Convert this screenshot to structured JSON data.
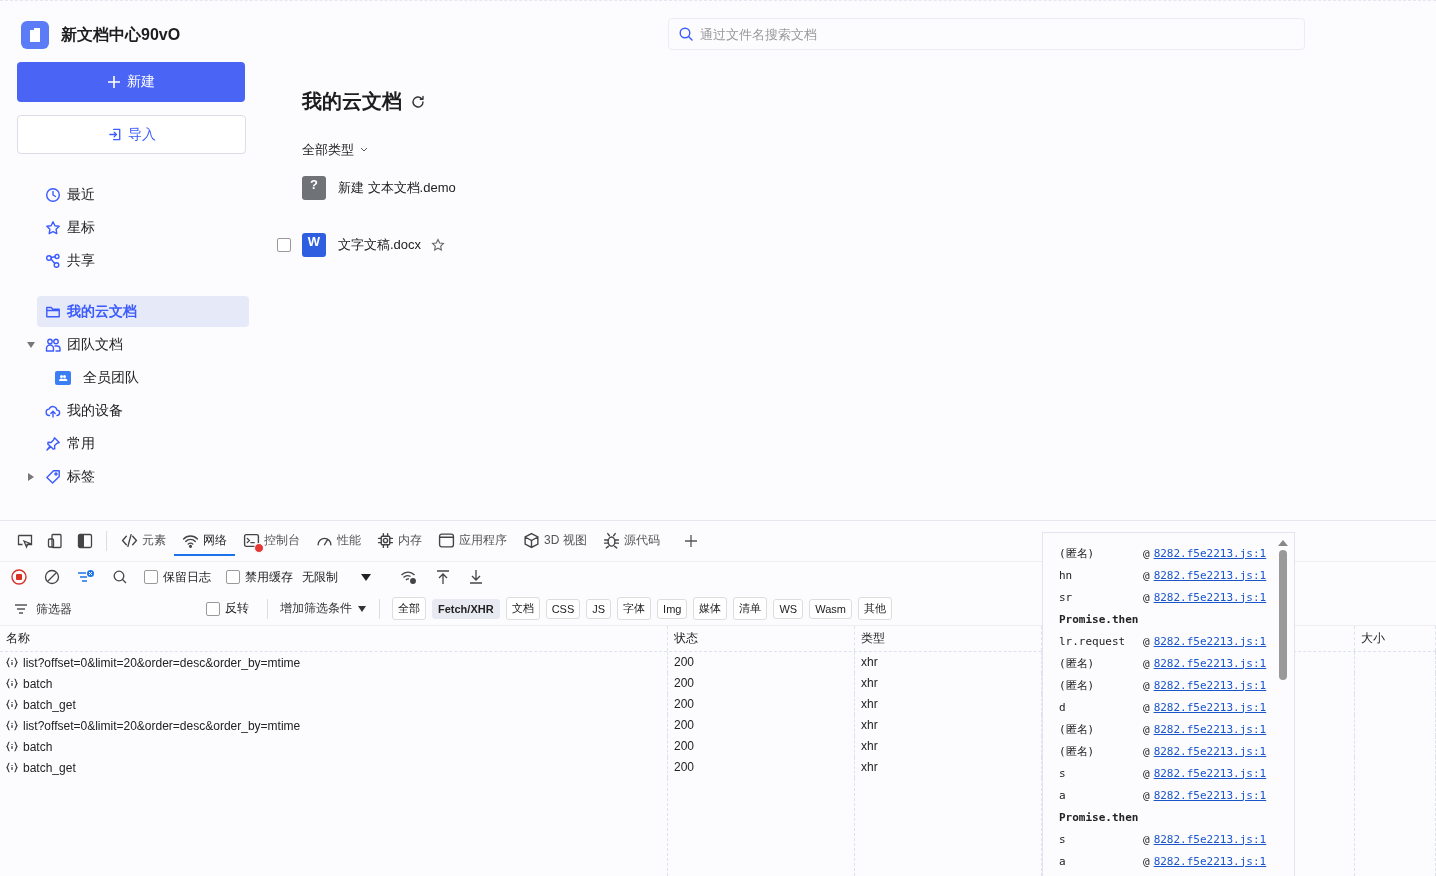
{
  "app": {
    "name": "新文档中心90vO",
    "new_button": "新建",
    "import_button": "导入"
  },
  "sidebar": {
    "sections": [
      {
        "items": [
          {
            "label": "最近",
            "kind": "link",
            "selected": false
          },
          {
            "label": "星标",
            "kind": "link",
            "selected": false
          },
          {
            "label": "共享",
            "kind": "link",
            "selected": false
          }
        ]
      },
      {
        "items": [
          {
            "label": "我的云文档",
            "kind": "link",
            "selected": true
          },
          {
            "label": "团队文档",
            "kind": "tree",
            "expanded": true,
            "selected": false,
            "children": [
              {
                "label": "全员团队",
                "kind": "team",
                "selected": false
              }
            ]
          },
          {
            "label": "我的设备",
            "kind": "link",
            "selected": false
          },
          {
            "label": "常用",
            "kind": "link",
            "selected": false
          },
          {
            "label": "标签",
            "kind": "tree",
            "expanded": false,
            "selected": false
          }
        ]
      }
    ]
  },
  "search": {
    "placeholder": "通过文件名搜索文档"
  },
  "main": {
    "title": "我的云文档",
    "type_filter": "全部类型",
    "files": [
      {
        "name": "新建 文本文档.demo",
        "kind": "unknown",
        "badge": "?"
      },
      {
        "name": "文字文稿.docx",
        "kind": "word",
        "badge": "W",
        "checked": false,
        "starred": false
      }
    ]
  },
  "devtools": {
    "tabs": [
      {
        "label": "元素",
        "selected": false,
        "error": false
      },
      {
        "label": "网络",
        "selected": true,
        "error": false
      },
      {
        "label": "控制台",
        "selected": false,
        "error": true
      },
      {
        "label": "性能",
        "selected": false,
        "error": false
      },
      {
        "label": "内存",
        "selected": false,
        "error": false
      },
      {
        "label": "应用程序",
        "selected": false,
        "error": false
      },
      {
        "label": "3D 视图",
        "selected": false,
        "error": false
      },
      {
        "label": "源代码",
        "selected": false,
        "error": false
      }
    ],
    "toolbar": {
      "preserve_log": {
        "label": "保留日志",
        "checked": false
      },
      "disable_cache": {
        "label": "禁用缓存",
        "checked": false
      },
      "throttling": "无限制"
    },
    "filter": {
      "placeholder": "筛选器",
      "invert": {
        "label": "反转",
        "checked": false
      },
      "more_filters": "增加筛选条件",
      "types": [
        {
          "label": "全部",
          "selected": false
        },
        {
          "label": "Fetch/XHR",
          "selected": true
        },
        {
          "label": "文档",
          "selected": false
        },
        {
          "label": "CSS",
          "selected": false
        },
        {
          "label": "JS",
          "selected": false
        },
        {
          "label": "字体",
          "selected": false
        },
        {
          "label": "Img",
          "selected": false
        },
        {
          "label": "媒体",
          "selected": false
        },
        {
          "label": "清单",
          "selected": false
        },
        {
          "label": "WS",
          "selected": false
        },
        {
          "label": "Wasm",
          "selected": false
        },
        {
          "label": "其他",
          "selected": false
        }
      ]
    },
    "table": {
      "columns": [
        "名称",
        "状态",
        "类型",
        "大小"
      ],
      "rows": [
        {
          "name": "list?offset=0&limit=20&order=desc&order_by=mtime",
          "status": "200",
          "type": "xhr"
        },
        {
          "name": "batch",
          "status": "200",
          "type": "xhr"
        },
        {
          "name": "batch_get",
          "status": "200",
          "type": "xhr"
        },
        {
          "name": "list?offset=0&limit=20&order=desc&order_by=mtime",
          "status": "200",
          "type": "xhr"
        },
        {
          "name": "batch",
          "status": "200",
          "type": "xhr"
        },
        {
          "name": "batch_get",
          "status": "200",
          "type": "xhr"
        }
      ]
    },
    "stack_popup": {
      "frames": [
        {
          "kind": "frame",
          "function": "(匿名)",
          "at": "@",
          "location": "8282.f5e2213.js:1"
        },
        {
          "kind": "frame",
          "function": "hn",
          "at": "@",
          "location": "8282.f5e2213.js:1"
        },
        {
          "kind": "frame",
          "function": "sr",
          "at": "@",
          "location": "8282.f5e2213.js:1"
        },
        {
          "kind": "async",
          "function": "Promise.then"
        },
        {
          "kind": "frame",
          "function": "lr.request",
          "at": "@",
          "location": "8282.f5e2213.js:1"
        },
        {
          "kind": "frame",
          "function": "(匿名)",
          "at": "@",
          "location": "8282.f5e2213.js:1"
        },
        {
          "kind": "frame",
          "function": "(匿名)",
          "at": "@",
          "location": "8282.f5e2213.js:1"
        },
        {
          "kind": "frame",
          "function": "d",
          "at": "@",
          "location": "8282.f5e2213.js:1"
        },
        {
          "kind": "frame",
          "function": "(匿名)",
          "at": "@",
          "location": "8282.f5e2213.js:1"
        },
        {
          "kind": "frame",
          "function": "(匿名)",
          "at": "@",
          "location": "8282.f5e2213.js:1"
        },
        {
          "kind": "frame",
          "function": "s",
          "at": "@",
          "location": "8282.f5e2213.js:1"
        },
        {
          "kind": "frame",
          "function": "a",
          "at": "@",
          "location": "8282.f5e2213.js:1"
        },
        {
          "kind": "async",
          "function": "Promise.then"
        },
        {
          "kind": "frame",
          "function": "s",
          "at": "@",
          "location": "8282.f5e2213.js:1"
        },
        {
          "kind": "frame",
          "function": "a",
          "at": "@",
          "location": "8282.f5e2213.js:1"
        }
      ]
    }
  }
}
